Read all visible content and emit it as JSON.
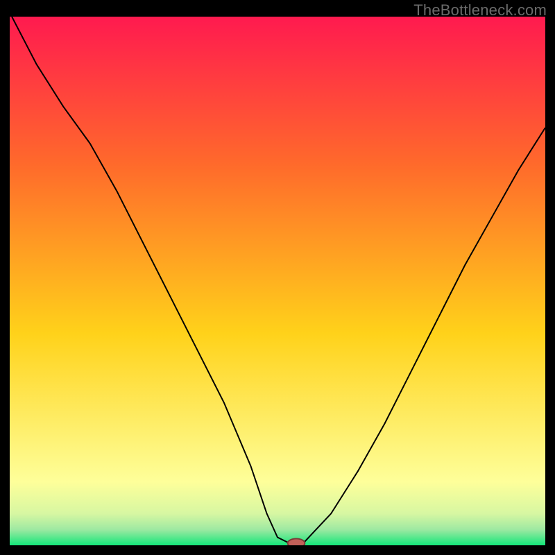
{
  "watermark": "TheBottleneck.com",
  "colors": {
    "frame": "#000000",
    "gradient_top": "#ff1a4f",
    "gradient_upper": "#ff6a2b",
    "gradient_mid": "#ffd21a",
    "gradient_lower": "#feff9a",
    "gradient_band1": "#d7f7a2",
    "gradient_band2": "#9ee9a2",
    "gradient_bottom": "#14e67a",
    "curve": "#000000",
    "marker_fill": "#c26059",
    "marker_stroke": "#7a3a36"
  },
  "chart_data": {
    "type": "line",
    "title": "",
    "xlabel": "",
    "ylabel": "",
    "xlim": [
      0,
      100
    ],
    "ylim": [
      0,
      100
    ],
    "grid": false,
    "series": [
      {
        "name": "bottleneck-curve",
        "x": [
          0.4,
          5,
          10,
          15,
          20,
          25,
          30,
          35,
          40,
          45,
          48,
          50,
          52,
          53,
          54,
          55,
          60,
          65,
          70,
          75,
          80,
          85,
          90,
          95,
          100
        ],
        "y": [
          100,
          91,
          83,
          76,
          67,
          57,
          47,
          37,
          27,
          15,
          6,
          1.5,
          0.5,
          0.4,
          0.4,
          0.6,
          6,
          14,
          23,
          33,
          43,
          53,
          62,
          71,
          79
        ]
      }
    ],
    "marker": {
      "x": 53.5,
      "y": 0.4,
      "rx": 1.6,
      "ry": 0.85
    }
  }
}
